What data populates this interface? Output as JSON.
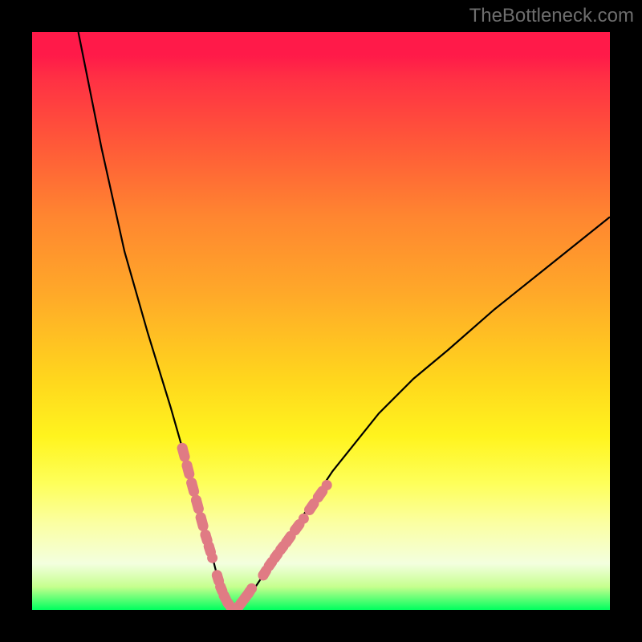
{
  "watermark": "TheBottleneck.com",
  "chart_data": {
    "type": "line",
    "title": "",
    "xlabel": "",
    "ylabel": "",
    "xlim": [
      0,
      100
    ],
    "ylim": [
      0,
      100
    ],
    "grid": false,
    "legend": false,
    "curve_note": "V-shaped curve; vertical axis read as 100 (bottom) to 0 (top). Left branch enters near x≈8 at top, dips to ≈100 at x≈35, rises to ≈30 by x≈100.",
    "x": [
      8,
      12,
      16,
      20,
      24,
      26,
      28,
      30,
      31,
      32,
      33,
      34,
      35,
      36,
      38,
      40,
      44,
      48,
      52,
      56,
      60,
      66,
      72,
      80,
      90,
      100
    ],
    "y": [
      0,
      20,
      38,
      52,
      65,
      72,
      79,
      86,
      90,
      94,
      97,
      99,
      100,
      99,
      97,
      94,
      88,
      82,
      76,
      71,
      66,
      60,
      55,
      48,
      40,
      32
    ],
    "highlight_segments": [
      {
        "x": [
          26.0,
          26.8,
          27.6,
          28.4,
          29.2,
          30.0,
          30.6,
          31.2
        ],
        "y": [
          72,
          75,
          78,
          81,
          84,
          87,
          89,
          91
        ]
      },
      {
        "x": [
          32.0,
          32.6,
          33.2,
          33.8,
          34.4,
          35.0,
          35.6,
          36.2,
          36.8,
          37.4,
          38.0
        ],
        "y": [
          94,
          96,
          97.5,
          98.7,
          99.5,
          100,
          99.6,
          98.8,
          98.0,
          97.2,
          96.3
        ]
      },
      {
        "x": [
          40.0,
          41.0,
          42.0,
          43.0,
          44.0,
          45.5,
          47.0
        ],
        "y": [
          94,
          92.4,
          91.0,
          89.6,
          88.3,
          86.2,
          84.2
        ]
      },
      {
        "x": [
          48.0,
          49.5,
          51.0
        ],
        "y": [
          82.7,
          80.5,
          78.4
        ]
      }
    ],
    "colors": {
      "curve": "#000000",
      "highlight": "#e07b84",
      "background_gradient_top": "#ff1a49",
      "background_gradient_mid": "#ffe022",
      "background_gradient_bottom": "#00ff5f"
    }
  }
}
